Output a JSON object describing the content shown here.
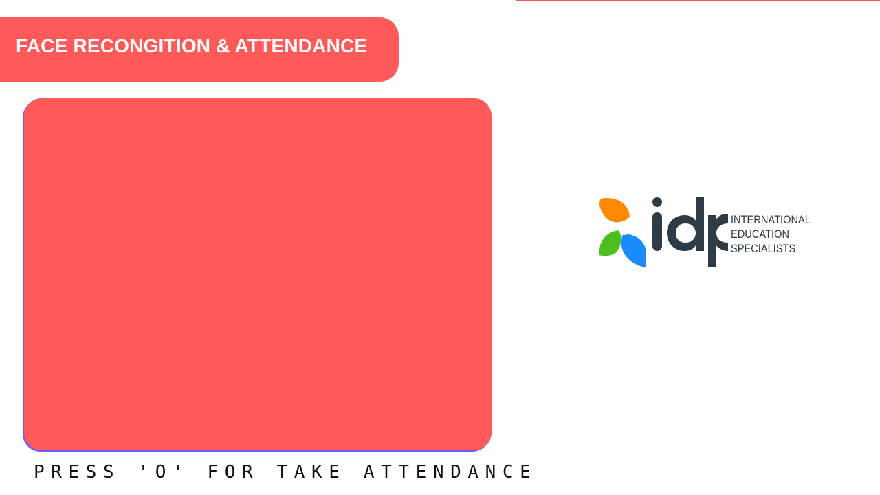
{
  "header": {
    "title": "FACE RECONGITION & ATTENDANCE"
  },
  "camera": {
    "instruction": "PRESS 'O' FOR TAKE ATTENDANCE"
  },
  "logo": {
    "wordmark": "idp",
    "tagline_lines": [
      "INTERNATIONAL",
      "EDUCATION",
      "SPECIALISTS"
    ]
  },
  "colors": {
    "accent": "#ff5a5a",
    "frame_edge": "#6a5cff",
    "petal_orange": "#ff8a00",
    "petal_green": "#4cbf1f",
    "petal_blue": "#1a8cff",
    "wordmark": "#2e3a44"
  }
}
